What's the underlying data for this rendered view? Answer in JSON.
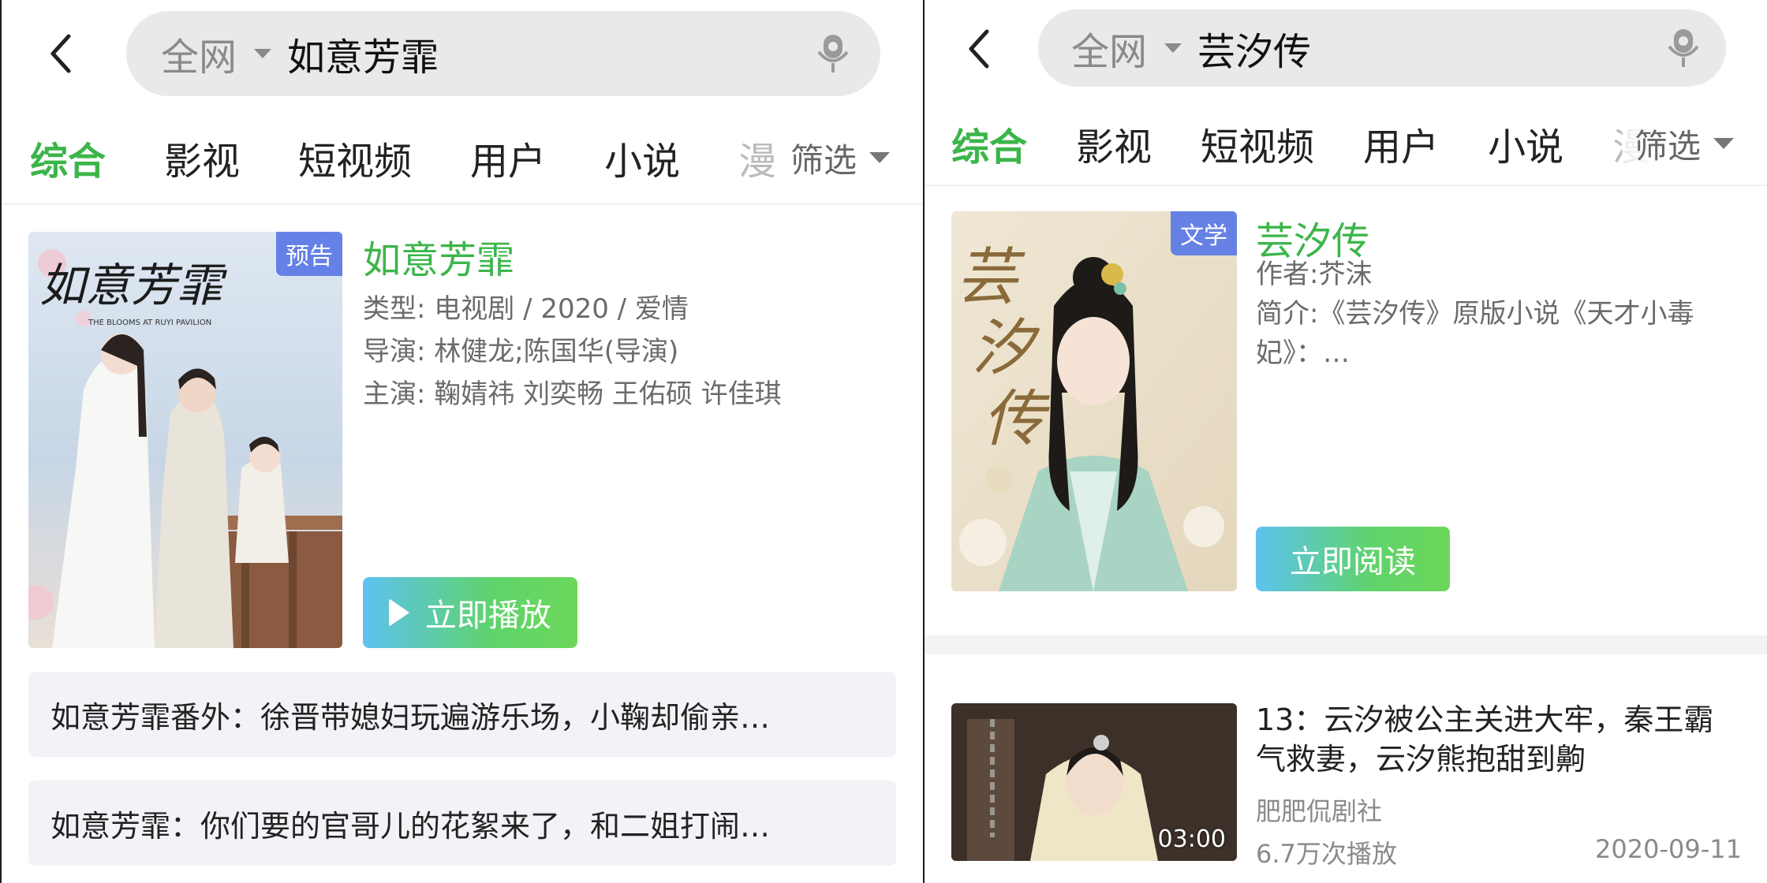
{
  "left": {
    "search": {
      "scope": "全网",
      "query": "如意芳霏"
    },
    "tabs": [
      "综合",
      "影视",
      "短视频",
      "用户",
      "小说",
      "漫"
    ],
    "filter_label": "筛选",
    "card": {
      "badge": "预告",
      "poster_calligraphy": "如意芳霏",
      "poster_subtitle": "THE BLOOMS AT RUYI PAVILION",
      "title": "如意芳霏",
      "type_line": "类型: 电视剧 / 2020 / 爱情",
      "director_line": "导演: 林健龙;陈国华(导演)",
      "cast_line": "主演: 鞠婧祎  刘奕畅  王佑硕  许佳琪",
      "cta_label": "立即播放"
    },
    "related": [
      "如意芳霏番外：徐晋带媳妇玩遍游乐场，小鞠却偷亲…",
      "如意芳霏：你们要的官哥儿的花絮来了，和二姐打闹…"
    ]
  },
  "right": {
    "search": {
      "scope": "全网",
      "query": "芸汐传"
    },
    "tabs": [
      "综合",
      "影视",
      "短视频",
      "用户",
      "小说",
      "漫"
    ],
    "filter_label": "筛选",
    "card": {
      "badge": "文学",
      "poster_calligraphy": "芸汐传",
      "title": "芸汐传",
      "author_line": "作者:芥沫",
      "summary_line1": "简介:《芸汐传》原版小说《天才小毒",
      "summary_line2": "妃》：…",
      "cta_label": "立即阅读"
    },
    "video": {
      "duration": "03:00",
      "title": "13：云汐被公主关进大牢，秦王霸气救妻，云汐熊抱甜到齁",
      "author": "肥肥侃剧社",
      "plays": "6.7万次播放",
      "date": "2020-09-11"
    }
  },
  "colors": {
    "accent_green": "#3cb54a",
    "badge_blue": "#5a78e6",
    "search_bg": "#e9e9eb",
    "related_bg": "#f2f3f7"
  },
  "icons": [
    "back-chevron-icon",
    "dropdown-caret-icon",
    "microphone-icon",
    "play-icon",
    "filter-caret-icon"
  ]
}
